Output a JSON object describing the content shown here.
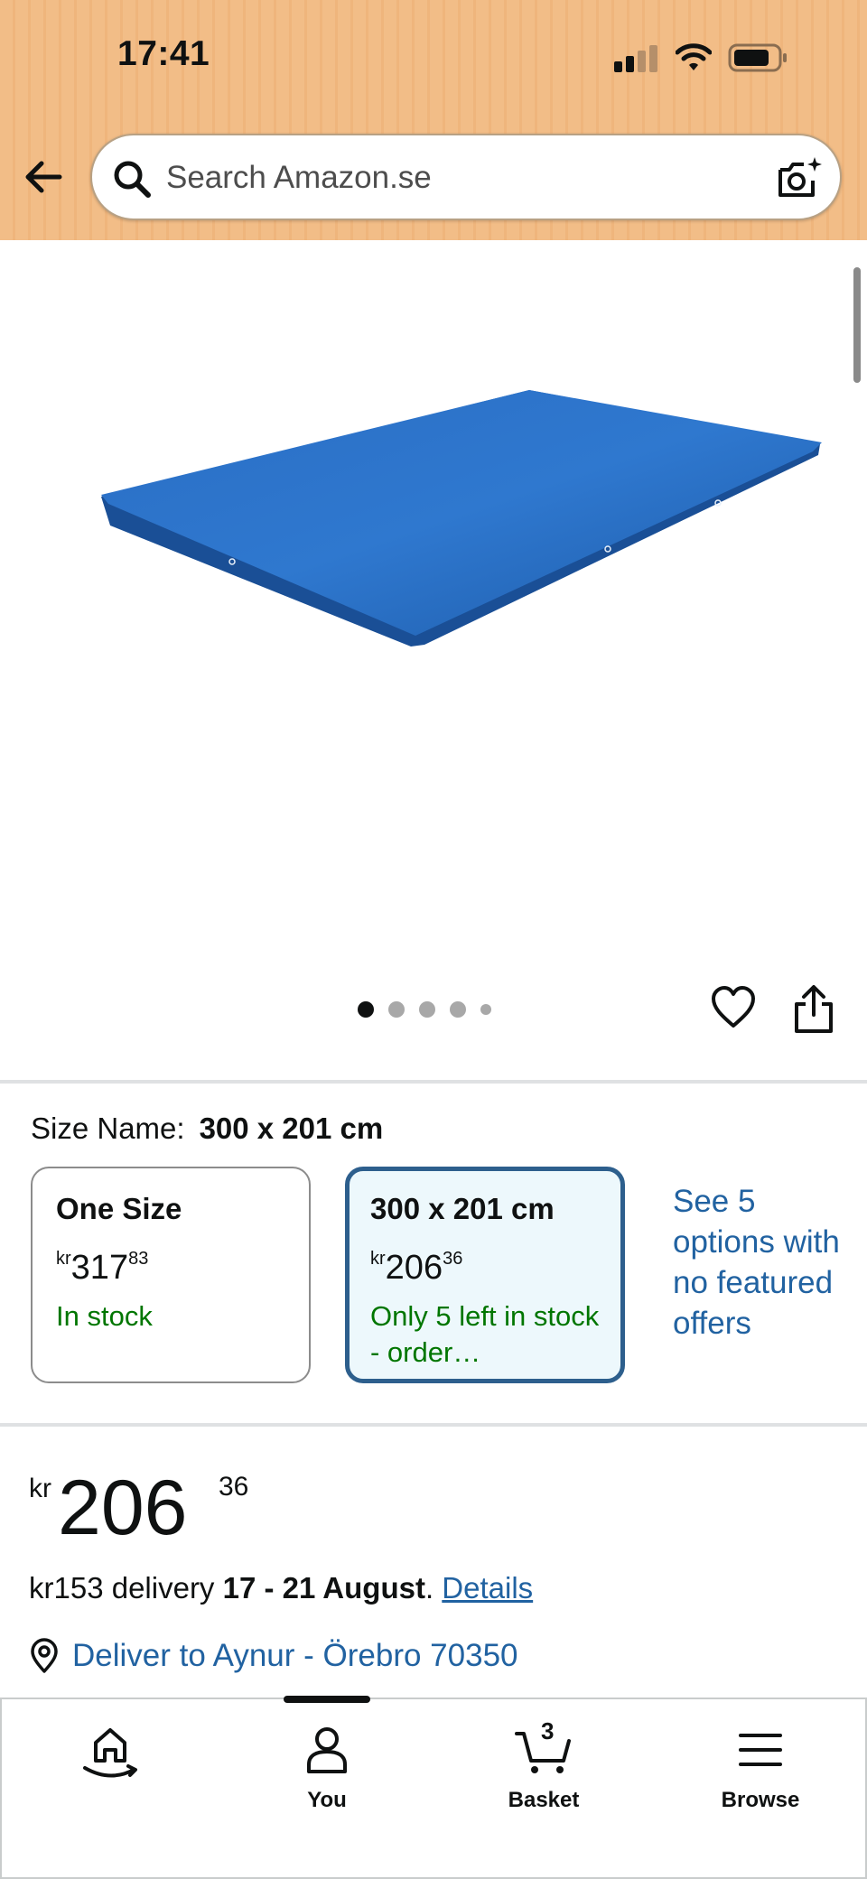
{
  "status_bar": {
    "time": "17:41"
  },
  "search": {
    "placeholder": "Search Amazon.se"
  },
  "gallery": {
    "image_count": 5,
    "active_index": 0
  },
  "size_selector": {
    "label": "Size Name:",
    "selected_value": "300 x 201 cm",
    "options": [
      {
        "name": "One Size",
        "currency": "kr",
        "price_whole": "317",
        "price_fraction": "83",
        "stock": "In stock",
        "selected": false
      },
      {
        "name": "300 x 201 cm",
        "currency": "kr",
        "price_whole": "206",
        "price_fraction": "36",
        "stock": "Only 5 left in stock - order…",
        "selected": true
      }
    ],
    "more_options_link": "See 5 options with no featured offers"
  },
  "price": {
    "currency": "kr",
    "whole": "206",
    "fraction": "36"
  },
  "delivery": {
    "fee_text": "kr153 delivery",
    "dates": "17 - 21 August",
    "period": ".",
    "details_link": "Details",
    "deliver_to": "Deliver to Aynur - Örebro 70350"
  },
  "bottom_nav": {
    "items": [
      {
        "label": "",
        "icon": "home-smile-icon"
      },
      {
        "label": "You",
        "icon": "person-icon"
      },
      {
        "label": "Basket",
        "icon": "cart-icon",
        "count": "3"
      },
      {
        "label": "Browse",
        "icon": "menu-icon"
      }
    ]
  },
  "colors": {
    "header_bg": "#f2bd87",
    "link": "#2162a1",
    "in_stock": "#007600",
    "selected_border": "#2d5f8d",
    "selected_bg": "#edf8fc",
    "product_blue": "#1f5fb0"
  }
}
